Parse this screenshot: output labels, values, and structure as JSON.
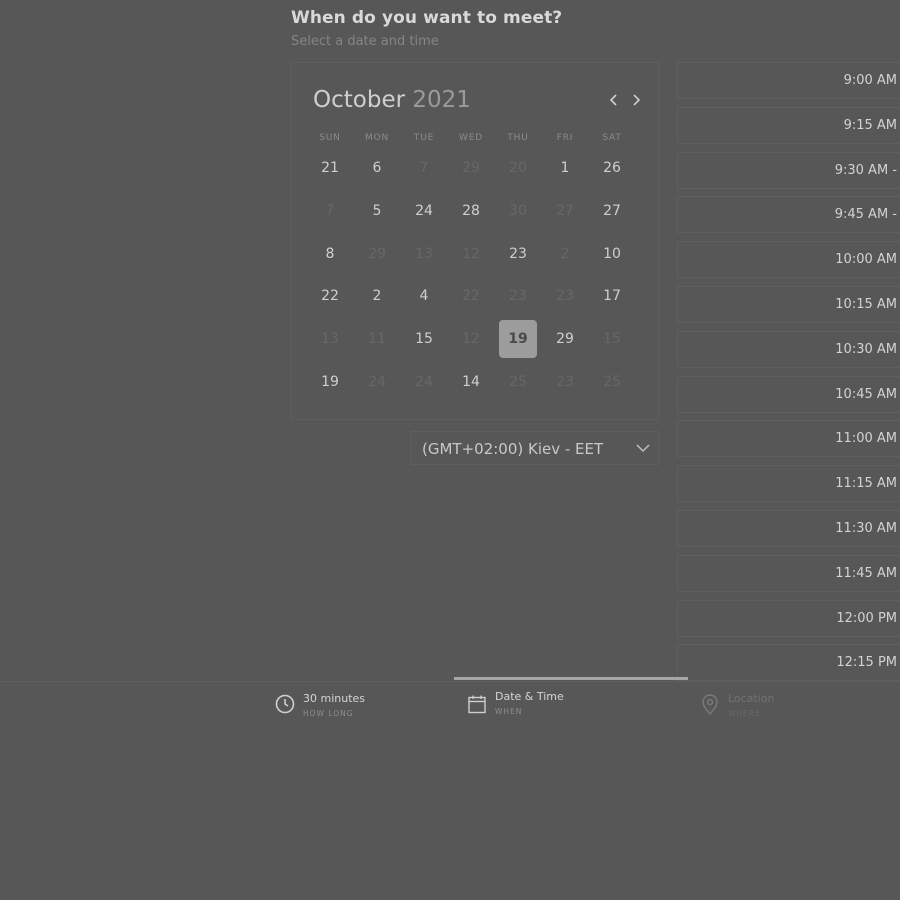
{
  "header": {
    "title": "When do you want to meet?",
    "subtitle": "Select a date and time"
  },
  "calendar": {
    "month": "October",
    "year": "2021",
    "prev_icon": "chevron-left-icon",
    "next_icon": "chevron-right-icon",
    "weekdays": [
      "SUN",
      "MON",
      "TUE",
      "WED",
      "THU",
      "FRI",
      "SAT"
    ],
    "weeks": [
      [
        {
          "d": "21",
          "dis": false
        },
        {
          "d": "6",
          "dis": false
        },
        {
          "d": "7",
          "dis": true
        },
        {
          "d": "29",
          "dis": true
        },
        {
          "d": "20",
          "dis": true
        },
        {
          "d": "1",
          "dis": false
        },
        {
          "d": "26",
          "dis": false
        }
      ],
      [
        {
          "d": "7",
          "dis": true
        },
        {
          "d": "5",
          "dis": false
        },
        {
          "d": "24",
          "dis": false
        },
        {
          "d": "28",
          "dis": false
        },
        {
          "d": "30",
          "dis": true
        },
        {
          "d": "27",
          "dis": true
        },
        {
          "d": "27",
          "dis": false
        }
      ],
      [
        {
          "d": "8",
          "dis": false
        },
        {
          "d": "29",
          "dis": true
        },
        {
          "d": "13",
          "dis": true
        },
        {
          "d": "12",
          "dis": true
        },
        {
          "d": "23",
          "dis": false
        },
        {
          "d": "2",
          "dis": true
        },
        {
          "d": "10",
          "dis": false
        }
      ],
      [
        {
          "d": "22",
          "dis": false
        },
        {
          "d": "2",
          "dis": false
        },
        {
          "d": "4",
          "dis": false
        },
        {
          "d": "22",
          "dis": true
        },
        {
          "d": "23",
          "dis": true
        },
        {
          "d": "23",
          "dis": true
        },
        {
          "d": "17",
          "dis": false
        }
      ],
      [
        {
          "d": "13",
          "dis": true
        },
        {
          "d": "11",
          "dis": true
        },
        {
          "d": "15",
          "dis": false
        },
        {
          "d": "12",
          "dis": true
        },
        {
          "d": "19",
          "dis": false,
          "selected": true
        },
        {
          "d": "29",
          "dis": false
        },
        {
          "d": "15",
          "dis": true
        }
      ],
      [
        {
          "d": "19",
          "dis": false
        },
        {
          "d": "24",
          "dis": true
        },
        {
          "d": "24",
          "dis": true
        },
        {
          "d": "14",
          "dis": false
        },
        {
          "d": "25",
          "dis": true
        },
        {
          "d": "23",
          "dis": true
        },
        {
          "d": "25",
          "dis": true
        }
      ]
    ]
  },
  "timezone": {
    "label": "(GMT+02:00) Kiev - EET",
    "icon": "chevron-down-icon"
  },
  "time_slots": [
    "9:00 AM",
    "9:15 AM",
    "9:30 AM -",
    "9:45 AM -",
    "10:00 AM",
    "10:15 AM",
    "10:30 AM",
    "10:45 AM",
    "11:00 AM",
    "11:15 AM",
    "11:30 AM",
    "11:45 AM",
    "12:00 PM",
    "12:15 PM"
  ],
  "steps": [
    {
      "label": "30 minutes",
      "sub": "HOW LONG",
      "icon": "clock-icon"
    },
    {
      "label": "Date & Time",
      "sub": "WHEN",
      "icon": "calendar-icon"
    },
    {
      "label": "Location",
      "sub": "WHERE",
      "icon": "location-pin-icon"
    }
  ],
  "colors": {
    "background": "#575757",
    "selected_day": "#9c9c9c",
    "progress": "#a6a6a6"
  }
}
